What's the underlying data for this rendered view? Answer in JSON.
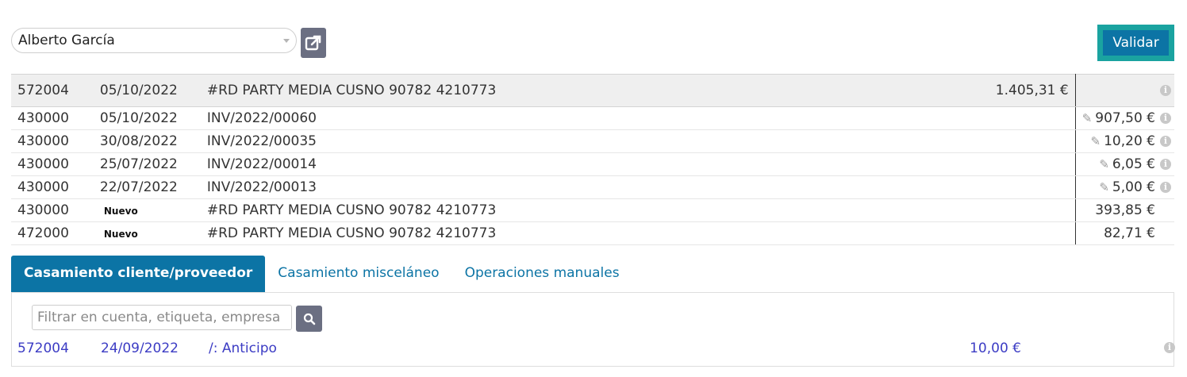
{
  "partner": {
    "name": "Alberto García"
  },
  "toolbar": {
    "validate_label": "Validar"
  },
  "header_line": {
    "account": "572004",
    "date": "05/10/2022",
    "label": "#RD PARTY MEDIA CUSNO 90782 4210773",
    "debit": "1.405,31 €"
  },
  "lines": [
    {
      "account": "430000",
      "date": "05/10/2022",
      "label": "INV/2022/00060",
      "credit": "907,50 €"
    },
    {
      "account": "430000",
      "date": "30/08/2022",
      "label": "INV/2022/00035",
      "credit": "10,20 €"
    },
    {
      "account": "430000",
      "date": "25/07/2022",
      "label": "INV/2022/00014",
      "credit": "6,05 €"
    },
    {
      "account": "430000",
      "date": "22/07/2022",
      "label": "INV/2022/00013",
      "credit": "5,00 €"
    },
    {
      "account": "430000",
      "badge": "Nuevo",
      "label": "#RD PARTY MEDIA CUSNO 90782 4210773",
      "credit": "393,85 €"
    },
    {
      "account": "472000",
      "badge": "Nuevo",
      "label": "#RD PARTY MEDIA CUSNO 90782 4210773",
      "credit": "82,71 €"
    }
  ],
  "tabs": [
    {
      "label": "Casamiento cliente/proveedor",
      "active": true
    },
    {
      "label": "Casamiento misceláneo",
      "active": false
    },
    {
      "label": "Operaciones manuales",
      "active": false
    }
  ],
  "filter": {
    "placeholder": "Filtrar en cuenta, etiqueta, empresa"
  },
  "proposition": {
    "account": "572004",
    "date": "24/09/2022",
    "label": "/: Anticipo",
    "amount": "10,00 €"
  },
  "colors": {
    "primary": "#0c74a5",
    "accent": "#1aa3a0",
    "proposition_text": "#3c3cc4",
    "icon_button": "#6b6f82"
  }
}
